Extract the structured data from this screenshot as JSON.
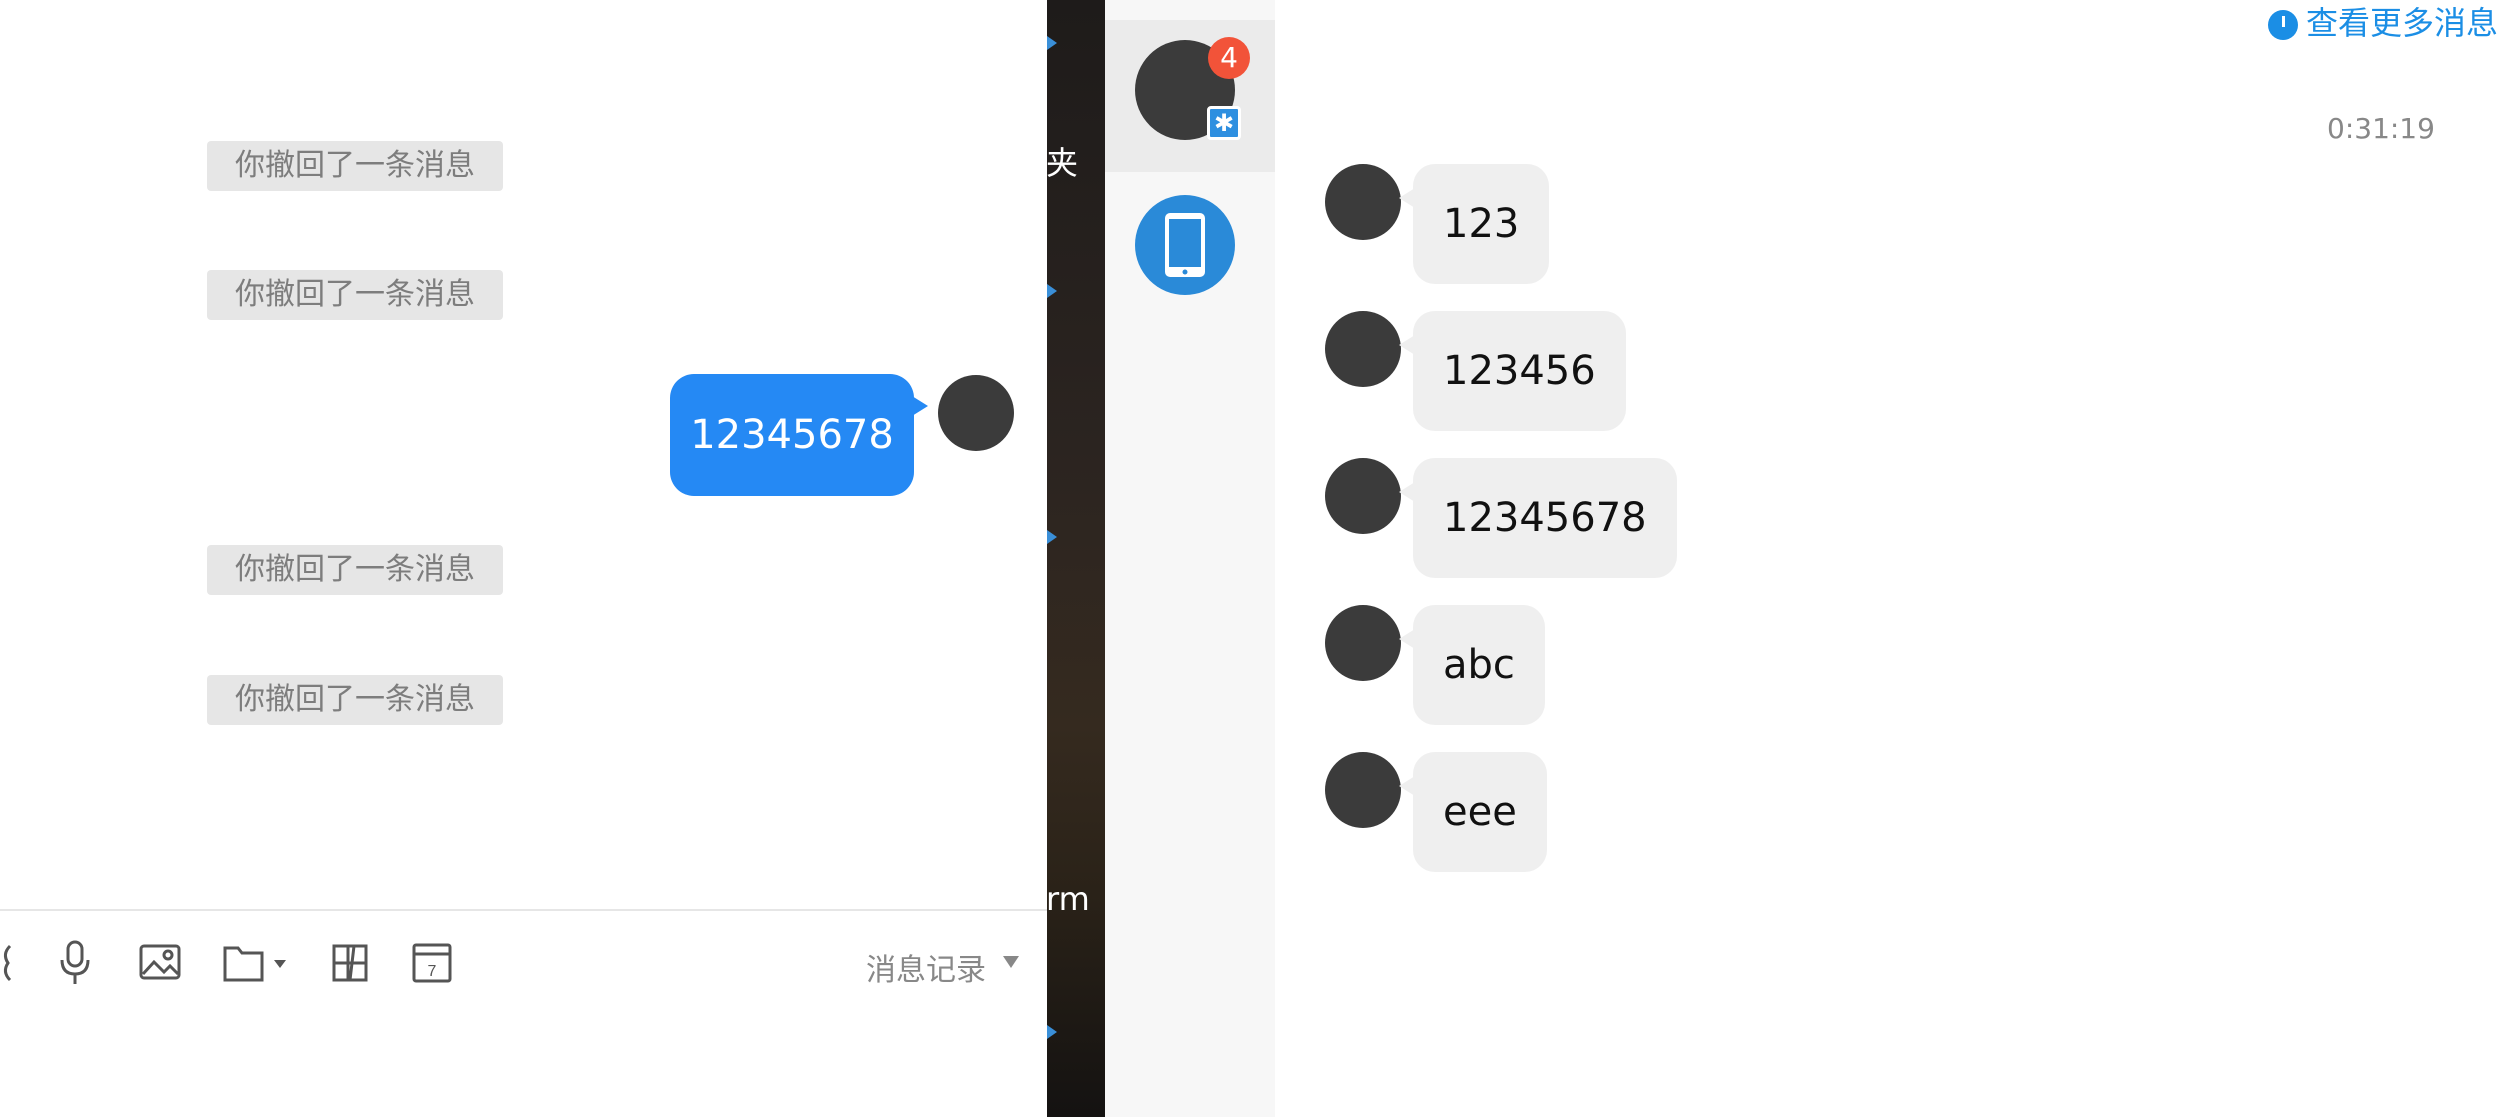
{
  "chat_left": {
    "recalled_text": "你撤回了一条消息",
    "sent_message": "12345678",
    "toolbar": {
      "icons": [
        "emoji-icon",
        "microphone-icon",
        "image-icon",
        "folder-icon",
        "screenshot-icon",
        "calendar-icon"
      ],
      "calendar_day": "7",
      "message_record_label": "消息记录"
    }
  },
  "desktop": {
    "label_top": "夹",
    "label_bottom": "rm"
  },
  "contacts": {
    "unread_badge": "4",
    "accent_color": "#2e8fe0",
    "badge_color": "#f25339"
  },
  "chat_right": {
    "view_more_label": "查看更多消息",
    "timestamp": "0:31:19",
    "messages": [
      "123",
      "123456",
      "12345678",
      "abc",
      "eee"
    ]
  }
}
